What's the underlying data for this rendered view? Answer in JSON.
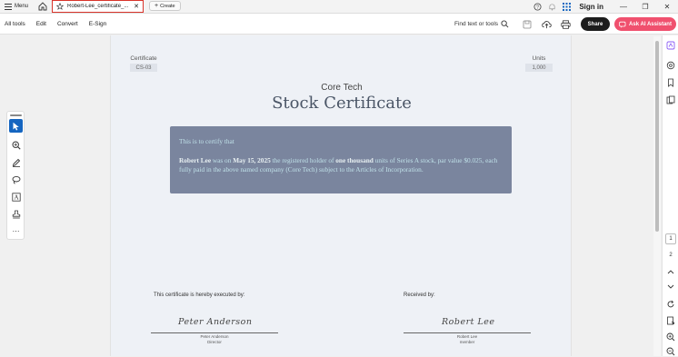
{
  "titlebar": {
    "menu_label": "Menu",
    "tab_label": "Robert-Lee_certificate_...",
    "create_label": "Create",
    "signin_label": "Sign in"
  },
  "toolbar": {
    "items": [
      "All tools",
      "Edit",
      "Convert",
      "E-Sign"
    ],
    "find_label": "Find text or tools",
    "share_label": "Share",
    "ai_label": "Ask AI Assistant"
  },
  "document": {
    "certificate_label": "Certificate",
    "certificate_value": "CS-03",
    "units_label": "Units",
    "units_value": "1,000",
    "company": "Core Tech",
    "title": "Stock Certificate",
    "certify_line": "This is to certify that",
    "body": {
      "name": "Robert Lee",
      "t1": " was on ",
      "date": "May 15, 2025",
      "t2": " the registered holder of ",
      "amount": "one thousand",
      "t3": " units of Series A stock, par value $0.025, each fully paid in the above named company (Core Tech) subject to the Articles of Incorporation."
    },
    "executed_by": "This certificate is hereby executed by:",
    "received_by": "Received by:",
    "left_signature": "Peter Anderson",
    "left_name": "Peter Anderson",
    "left_role": "Director",
    "right_signature": "Robert Lee",
    "right_name": "Robert Lee",
    "right_role": "member"
  },
  "pages": {
    "current": "1",
    "total": "2"
  },
  "colors": {
    "accent": "#1565c0",
    "ai_button": "#f0506e",
    "tab_border": "#d9342b",
    "panel": "#7a859e"
  }
}
